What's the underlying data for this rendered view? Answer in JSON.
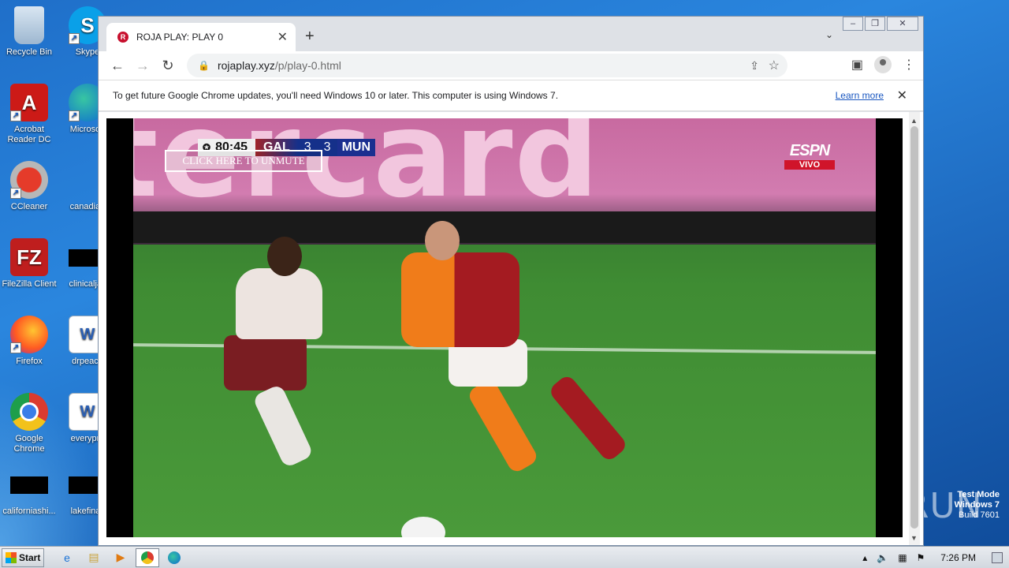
{
  "desktop": {
    "icons": [
      {
        "label": "Recycle Bin"
      },
      {
        "label": "Skype"
      },
      {
        "label": "Acrobat Reader DC"
      },
      {
        "label": "Microsoft"
      },
      {
        "label": "CCleaner"
      },
      {
        "label": "canadian"
      },
      {
        "label": "FileZilla Client"
      },
      {
        "label": "clinicaljac"
      },
      {
        "label": "Firefox"
      },
      {
        "label": "drpeace"
      },
      {
        "label": "Google Chrome"
      },
      {
        "label": "everypre"
      },
      {
        "label": "californiashi..."
      },
      {
        "label": "lakefinall"
      }
    ],
    "watermark": {
      "mode": "Test Mode",
      "os": "Windows 7",
      "build": "Build 7601"
    },
    "anyrun": "ANY RUN"
  },
  "browser": {
    "tab_title": "ROJA PLAY: PLAY 0",
    "tab_favicon": "R",
    "new_tab": "+",
    "url_host": "rojaplay.xyz",
    "url_path": "/p/play-0.html",
    "infobar_text": "To get future Google Chrome updates, you'll need Windows 10 or later. This computer is using Windows 7.",
    "infobar_link": "Learn more"
  },
  "video": {
    "clock": "80:45",
    "team_home": "GAL",
    "score_home": "3",
    "score_away": "3",
    "team_away": "MUN",
    "unmute_label": "CLICK HERE TO UNMUTE",
    "broadcaster": "ESPN",
    "live_label": "VIVO",
    "sponsor_text": "tercard"
  },
  "taskbar": {
    "start_label": "Start",
    "clock": "7:26 PM"
  }
}
